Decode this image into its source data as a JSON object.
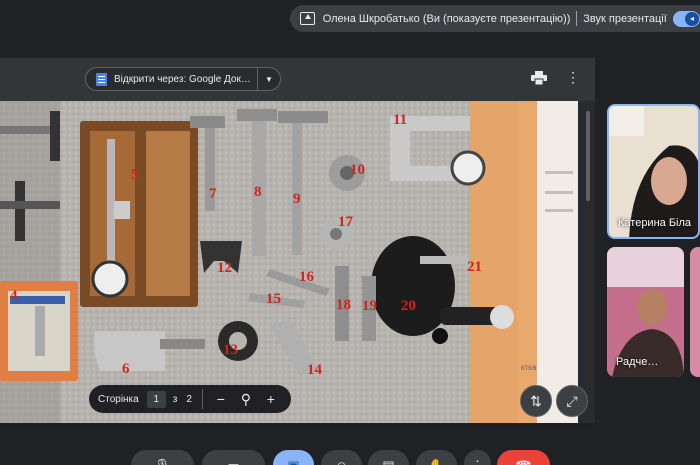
{
  "banner": {
    "presenter_text": "Олена Шкробатько (Ви (показуєте презентацію))",
    "audio_label": "Звук презентації"
  },
  "doc_toolbar": {
    "open_with_label": "Відкрити через: Google Док…",
    "print_icon": "print-icon",
    "more_icon": "more-vert-icon"
  },
  "photo": {
    "labels": [
      "5",
      "7",
      "8",
      "9",
      "10",
      "11",
      "17",
      "12",
      "16",
      "21",
      "15",
      "18",
      "19",
      "20",
      "6",
      "13",
      "14",
      "4"
    ],
    "label_color": "#d0241c"
  },
  "side_panel": {
    "notes_label": "ктка"
  },
  "pager": {
    "page_label": "Сторінка",
    "current_page": "1",
    "of_label": "з",
    "total_pages": "2"
  },
  "participants": [
    {
      "name": "Катерина Біла"
    },
    {
      "name": "Радче…"
    }
  ],
  "colors": {
    "accent": "#8ab4f8",
    "end_call": "#ea4335",
    "bar": "#3c4043"
  }
}
